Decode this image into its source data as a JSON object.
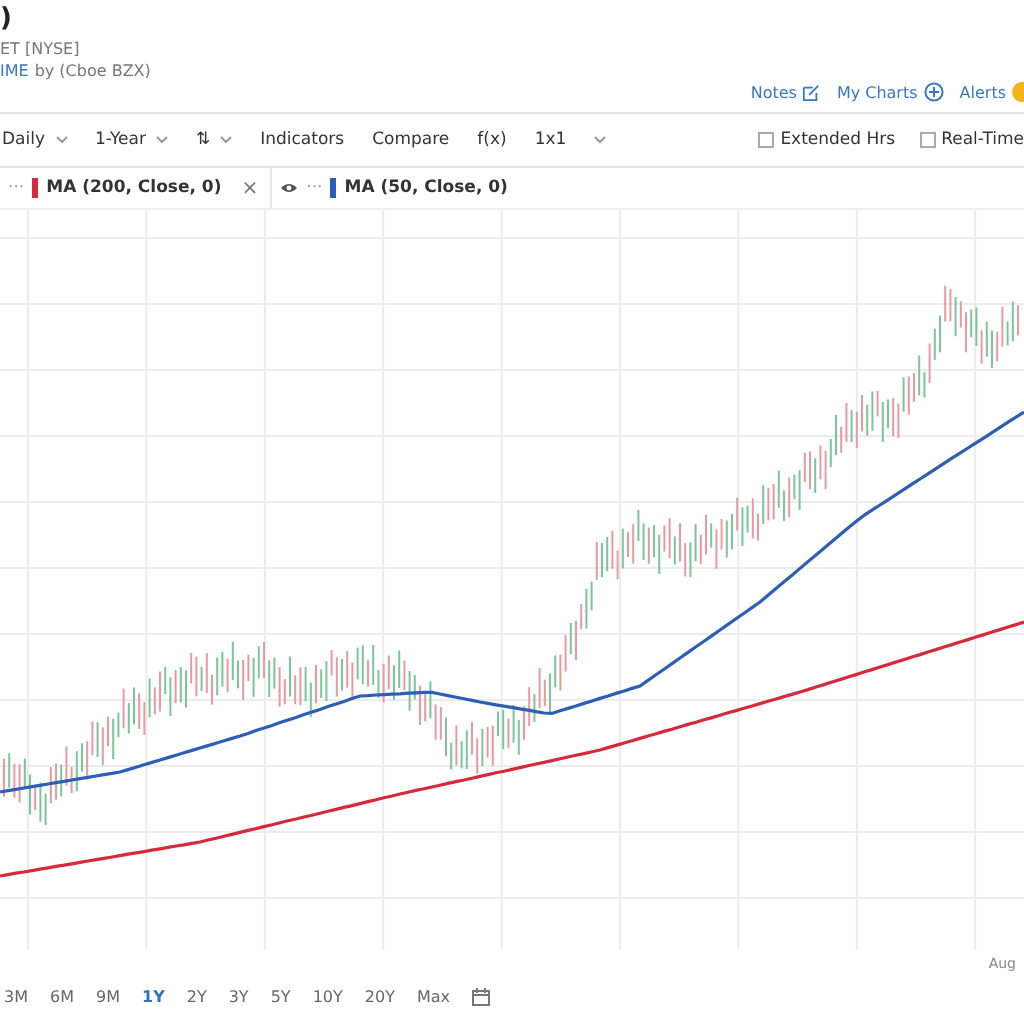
{
  "header": {
    "title": ")",
    "exchange": "ET [NYSE]",
    "feed_link": "IME",
    "feed_source": "by (Cboe BZX)"
  },
  "header_links": [
    {
      "label": "Notes",
      "kind": "notes"
    },
    {
      "label": "My Charts",
      "kind": "add"
    },
    {
      "label": "Alerts",
      "kind": "badge"
    }
  ],
  "toolbar": [
    {
      "label": "Daily",
      "kind": "dropdown"
    },
    {
      "label": "1-Year",
      "kind": "dropdown"
    },
    {
      "label": "⇅",
      "kind": "dropdown"
    },
    {
      "label": "Indicators",
      "kind": "button"
    },
    {
      "label": "Compare",
      "kind": "button"
    },
    {
      "label": "f(x)",
      "kind": "button"
    },
    {
      "label": "1x1",
      "kind": "button"
    },
    {
      "kind": "caret"
    }
  ],
  "checkboxes": [
    {
      "label": "Extended Hrs",
      "checked": false
    },
    {
      "label": "Real-Time",
      "checked": false
    }
  ],
  "legend": [
    {
      "menu": "···",
      "label": "MA (200, Close, 0)",
      "color": "#d42a3c",
      "close": "×"
    },
    {
      "menu": "···",
      "label": "MA (50, Close, 0)",
      "color": "#2c5fb3"
    }
  ],
  "x_axis_labels": [
    "Aug"
  ],
  "ranges": [
    {
      "label": "3M",
      "selected": false
    },
    {
      "label": "6M",
      "selected": false
    },
    {
      "label": "9M",
      "selected": false
    },
    {
      "label": "1Y",
      "selected": true
    },
    {
      "label": "2Y",
      "selected": false
    },
    {
      "label": "3Y",
      "selected": false
    },
    {
      "label": "5Y",
      "selected": false
    },
    {
      "label": "10Y",
      "selected": false
    },
    {
      "label": "20Y",
      "selected": false
    },
    {
      "label": "Max",
      "selected": false
    }
  ]
}
